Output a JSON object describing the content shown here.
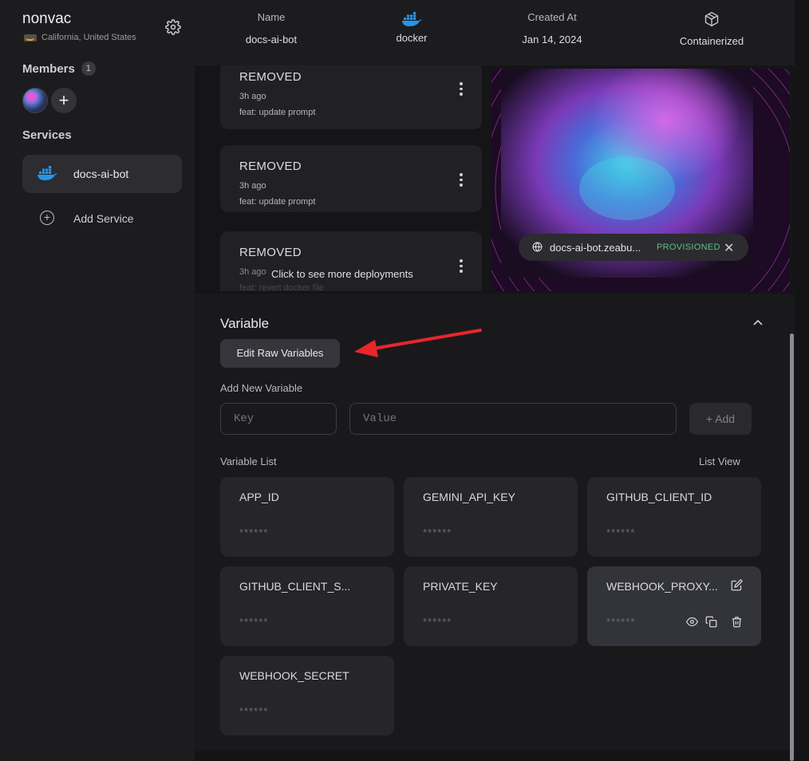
{
  "sidebar": {
    "project_name": "nonvac",
    "region": "California, United States",
    "members_label": "Members",
    "members_count": "1",
    "services_label": "Services",
    "services": [
      {
        "label": "docs-ai-bot",
        "icon": "docker-icon"
      }
    ],
    "add_service_label": "Add Service"
  },
  "header": {
    "name_label": "Name",
    "name_value": "docs-ai-bot",
    "image_value": "docker",
    "created_label": "Created At",
    "created_value": "Jan 14, 2024",
    "type_value": "Containerized"
  },
  "deployments": {
    "items": [
      {
        "status": "REMOVED",
        "time": "3h ago",
        "message": "feat: update prompt"
      },
      {
        "status": "REMOVED",
        "time": "3h ago",
        "message": "feat: update prompt"
      },
      {
        "status": "REMOVED",
        "time": "3h ago",
        "message": "feat: revert docker file"
      }
    ],
    "see_more": "Click to see more deployments",
    "domain": "docs-ai-bot.zeabu...",
    "domain_status": "PROVISIONED"
  },
  "variables": {
    "title": "Variable",
    "edit_raw_label": "Edit Raw Variables",
    "add_new_label": "Add New Variable",
    "key_placeholder": "Key",
    "value_placeholder": "Value",
    "add_button": "+ Add",
    "list_label": "Variable List",
    "list_view": "List View",
    "masked_value": "******",
    "items": [
      {
        "name": "APP_ID"
      },
      {
        "name": "GEMINI_API_KEY"
      },
      {
        "name": "GITHUB_CLIENT_ID"
      },
      {
        "name": "GITHUB_CLIENT_S..."
      },
      {
        "name": "PRIVATE_KEY"
      },
      {
        "name": "WEBHOOK_PROXY..."
      },
      {
        "name": "WEBHOOK_SECRET"
      }
    ]
  },
  "colors": {
    "background": "#141416",
    "sidebar": "#1c1c1f",
    "card": "#26262a",
    "accent_docker": "#2496ed",
    "provisioned": "#5ec27e",
    "annotation_arrow": "#e8262b"
  }
}
